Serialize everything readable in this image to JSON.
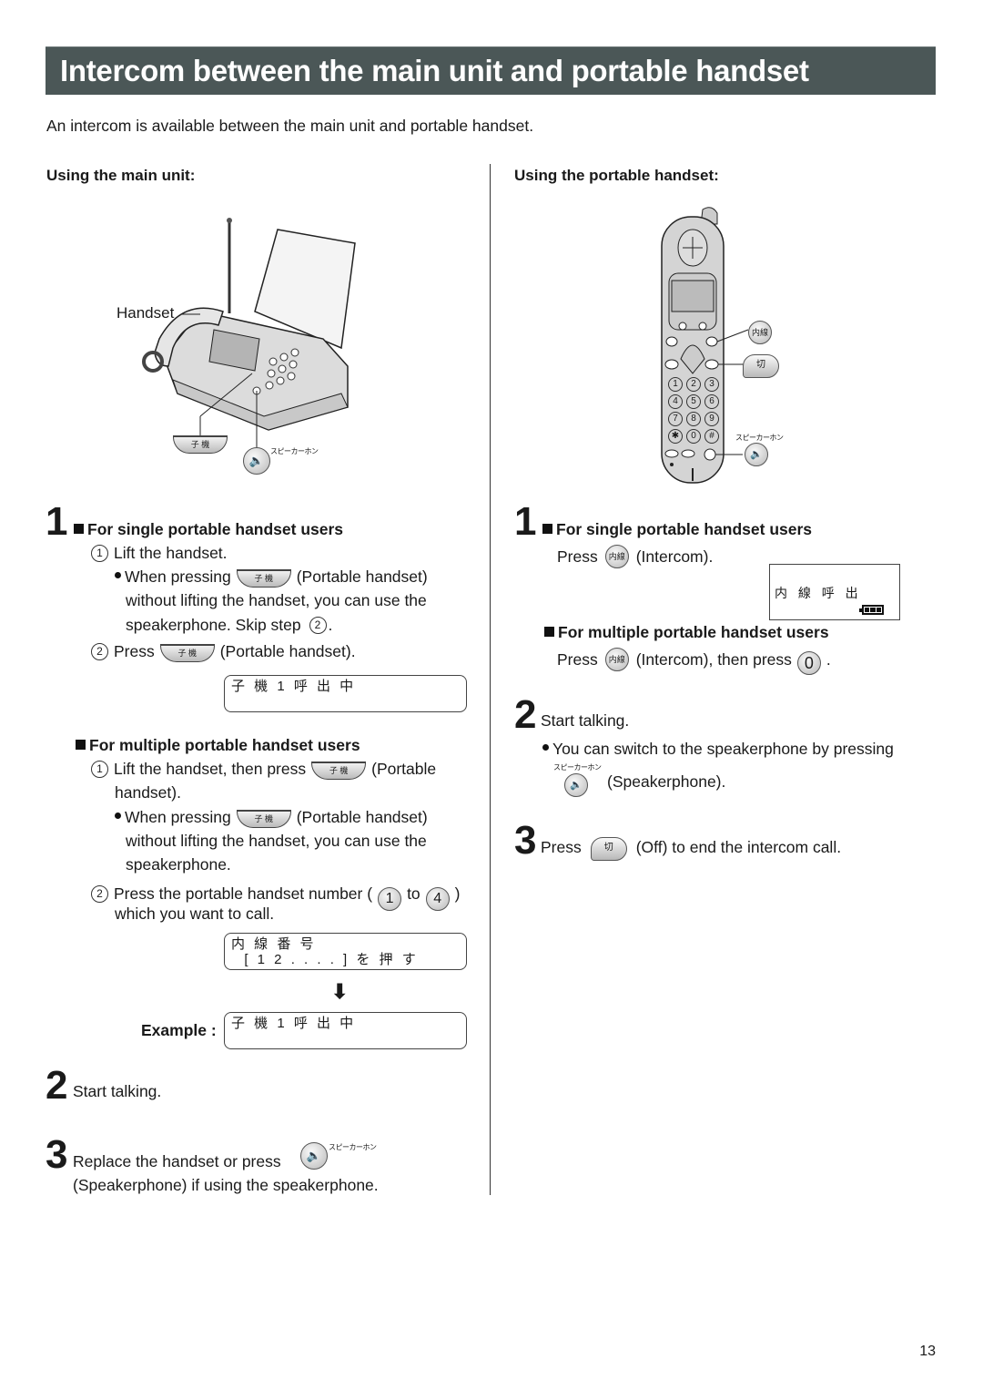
{
  "title": "Intercom between the main unit and portable handset",
  "intro": "An intercom is available between the main unit and portable handset.",
  "left": {
    "heading": "Using the main unit:",
    "figure": {
      "handset_label": "Handset",
      "koki_key": "子 機",
      "speaker_label": "スピーカーホン",
      "speaker_icon": "speaker-icon"
    },
    "step1": {
      "num": "1",
      "single_heading": "For single portable handset users",
      "single_sub1_num": "1",
      "single_sub1": "Lift the handset.",
      "single_bullet_a": "When pressing",
      "single_bullet_b": "(Portable handset)",
      "single_bullet_line2": "without lifting the handset, you can use the",
      "single_bullet_line3": "speakerphone. Skip step",
      "single_bullet_ref": "2",
      "single_sub2_num": "2",
      "single_sub2_a": "Press",
      "single_sub2_b": "(Portable handset).",
      "lcd1": "子 機 1 呼 出 中",
      "multi_heading": "For multiple portable handset users",
      "multi_sub1_num": "1",
      "multi_sub1_a": "Lift the handset, then press",
      "multi_sub1_b": "(Portable",
      "multi_sub1_line2": "handset).",
      "multi_bullet_a": "When pressing",
      "multi_bullet_b": "(Portable handset)",
      "multi_bullet_line2": "without lifting the handset, you can use the",
      "multi_bullet_line3": "speakerphone.",
      "multi_sub2_num": "2",
      "multi_sub2_a": "Press the portable handset number (",
      "multi_sub2_key1": "1",
      "multi_sub2_to": "to",
      "multi_sub2_key2": "4",
      "multi_sub2_close": ")",
      "multi_sub2_line2": "which you want to call.",
      "lcd2_line1": "内 線 番 号",
      "lcd2_line2": "  [ 1 2 . . . . ] を 押 す",
      "arrow": "🡇",
      "example_label": "Example :",
      "lcd3": "子 機 1 呼 出 中"
    },
    "step2": {
      "num": "2",
      "text": "Start talking."
    },
    "step3": {
      "num": "3",
      "text_a": "Replace the handset or press",
      "text_b": "(Speakerphone) if using the speakerphone.",
      "speaker_label": "スピーカーホン"
    }
  },
  "right": {
    "heading": "Using the portable handset:",
    "figure": {
      "intercom_key": "内線",
      "off_key": "切",
      "speaker_label": "スピーカーホン",
      "keypad": [
        "1",
        "2",
        "3",
        "4",
        "5",
        "6",
        "7",
        "8",
        "9",
        "✱",
        "0",
        "#"
      ]
    },
    "step1": {
      "num": "1",
      "single_heading": "For single portable handset users",
      "single_a": "Press",
      "single_key": "内線",
      "single_b": "(Intercom).",
      "lcd": "内 線 呼 出",
      "battery_level": "full",
      "multi_heading": "For multiple portable handset users",
      "multi_a": "Press",
      "multi_key": "内線",
      "multi_b": "(Intercom), then press",
      "multi_key2": "0",
      "multi_end": "."
    },
    "step2": {
      "num": "2",
      "text": "Start talking.",
      "bullet": "You can switch to the speakerphone by pressing",
      "speaker_label": "スピーカーホン",
      "speaker_text": "(Speakerphone)."
    },
    "step3": {
      "num": "3",
      "a": "Press",
      "key": "切",
      "b": "(Off) to end the intercom call."
    }
  },
  "page_number": "13"
}
